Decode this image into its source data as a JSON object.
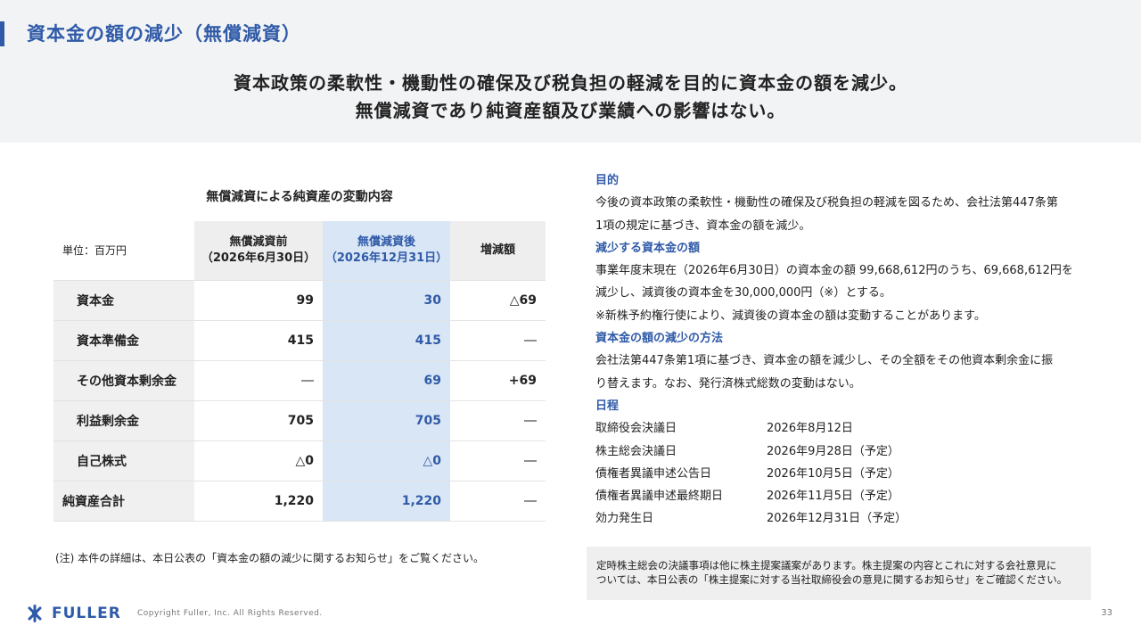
{
  "header": {
    "title": "資本金の額の減少（無償減資）",
    "headline_line1": "資本政策の柔軟性・機動性の確保及び税負担の軽減を目的に資本金の額を減少。",
    "headline_line2": "無償減資であり純資産額及び業績への影響はない。"
  },
  "table": {
    "caption": "無償減資による純資産の変動内容",
    "unit": "単位：百万円",
    "col_before_line1": "無償減資前",
    "col_before_line2": "（2026年6月30日）",
    "col_after_line1": "無償減資後",
    "col_after_line2": "（2026年12月31日）",
    "col_diff": "増減額",
    "rows": [
      {
        "label": "資本金",
        "before": "99",
        "after": "30",
        "diff": "△69"
      },
      {
        "label": "資本準備金",
        "before": "415",
        "after": "415",
        "diff": "―"
      },
      {
        "label": "その他資本剰余金",
        "before": "―",
        "after": "69",
        "diff": "+69"
      },
      {
        "label": "利益剰余金",
        "before": "705",
        "after": "705",
        "diff": "―"
      },
      {
        "label": "自己株式",
        "before": "△0",
        "after": "△0",
        "diff": "―"
      },
      {
        "label": "純資産合計",
        "before": "1,220",
        "after": "1,220",
        "diff": "―"
      }
    ],
    "note": "(注) 本件の詳細は、本日公表の「資本金の額の減少に関するお知らせ」をご覧ください。"
  },
  "details": {
    "purpose_head": "目的",
    "purpose_line1": "今後の資本政策の柔軟性・機動性の確保及び税負担の軽減を図るため、会社法第447条第",
    "purpose_line2": "1項の規定に基づき、資本金の額を減少。",
    "amount_head": "減少する資本金の額",
    "amount_line1": "事業年度末現在（2026年6月30日）の資本金の額 99,668,612円のうち、69,668,612円を",
    "amount_line2": "減少し、減資後の資本金を30,000,000円（※）とする。",
    "amount_line3": "※新株予約権行使により、減資後の資本金の額は変動することがあります。",
    "method_head": "資本金の額の減少の方法",
    "method_line1": "会社法第447条第1項に基づき、資本金の額を減少し、その全額をその他資本剰余金に振",
    "method_line2": "り替えます。なお、発行済株式総数の変動はない。",
    "schedule_head": "日程",
    "schedule": [
      {
        "label": "取締役会決議日",
        "date": "2026年8月12日"
      },
      {
        "label": "株主総会決議日",
        "date": "2026年9月28日（予定）"
      },
      {
        "label": "債権者異議申述公告日",
        "date": "2026年10月5日（予定）"
      },
      {
        "label": "債権者異議申述最終期日",
        "date": "2026年11月5日（予定）"
      },
      {
        "label": "効力発生日",
        "date": "2026年12月31日（予定）"
      }
    ]
  },
  "notice": {
    "line1": "定時株主総会の決議事項は他に株主提案議案があります。株主提案の内容とこれに対する会社意見に",
    "line2": "ついては、本日公表の「株主提案に対する当社取締役会の意見に関するお知らせ」をご確認ください。"
  },
  "footer": {
    "logo_text": "FULLER",
    "copyright": "Copyright Fuller, Inc. All Rights Reserved.",
    "page_number": "33"
  },
  "colors": {
    "accent": "#2f5aa8",
    "highlight_column": "#d9e6f5",
    "band": "#f2f3f5"
  }
}
